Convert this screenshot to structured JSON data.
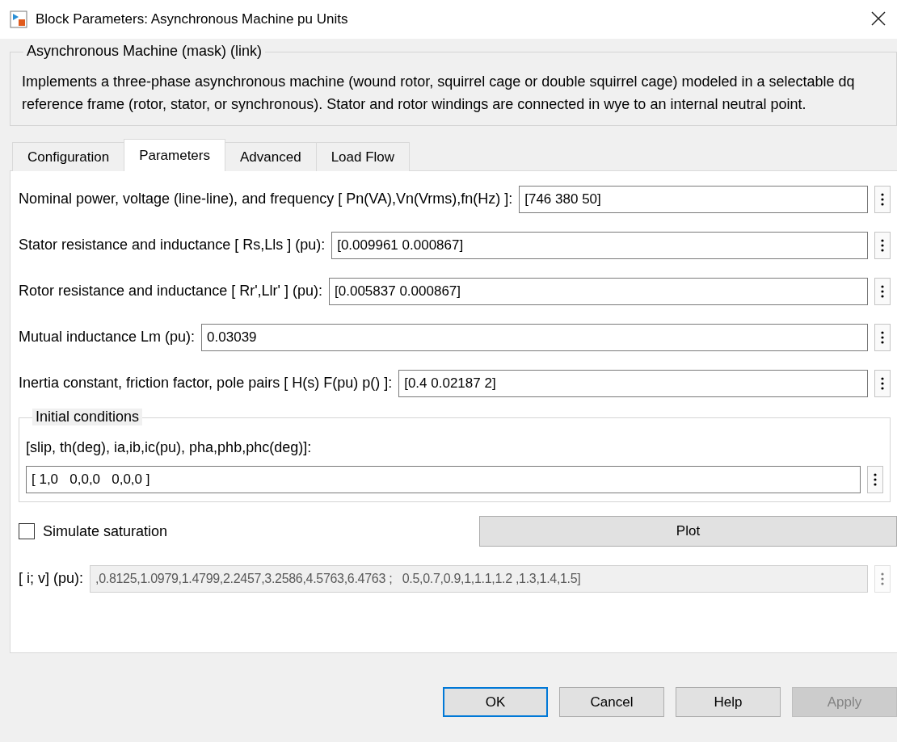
{
  "window": {
    "title": "Block Parameters: Asynchronous Machine pu Units"
  },
  "description": {
    "title": "Asynchronous Machine (mask) (link)",
    "text": "Implements a three-phase asynchronous machine (wound rotor, squirrel cage or double squirrel cage) modeled in a selectable dq reference frame (rotor, stator, or synchronous). Stator and rotor windings are connected in wye to an internal neutral point."
  },
  "tabs": [
    {
      "label": "Configuration",
      "selected": false
    },
    {
      "label": "Parameters",
      "selected": true
    },
    {
      "label": "Advanced",
      "selected": false
    },
    {
      "label": "Load Flow",
      "selected": false
    }
  ],
  "parameters": [
    {
      "label": "Nominal power, voltage (line-line), and frequency  [ Pn(VA),Vn(Vrms),fn(Hz) ]:",
      "value": "[746 380 50]"
    },
    {
      "label": "Stator resistance and inductance  [ Rs,Lls ] (pu):",
      "value": "[0.009961 0.000867]"
    },
    {
      "label": "Rotor resistance and inductance  [ Rr',Llr' ] (pu):",
      "value": "[0.005837 0.000867]"
    },
    {
      "label": "Mutual inductance Lm (pu):",
      "value": "0.03039"
    },
    {
      "label": "Inertia constant, friction factor, pole pairs [ H(s) F(pu)  p() ]:",
      "value": "[0.4 0.02187 2]"
    }
  ],
  "initial_conditions": {
    "title": "Initial conditions",
    "label": "[slip, th(deg), ia,ib,ic(pu), pha,phb,phc(deg)]:",
    "value": "[ 1,0   0,0,0   0,0,0 ]"
  },
  "saturation": {
    "label": "Simulate saturation",
    "checked": false
  },
  "plot_button": "Plot",
  "saturation_data": {
    "label": "[ i; v] (pu):",
    "value": ",0.8125,1.0979,1.4799,2.2457,3.2586,4.5763,6.4763 ;   0.5,0.7,0.9,1,1.1,1.2 ,1.3,1.4,1.5]",
    "disabled": true
  },
  "buttons": [
    {
      "label": "OK",
      "kind": "default",
      "disabled": false
    },
    {
      "label": "Cancel",
      "kind": "normal",
      "disabled": false
    },
    {
      "label": "Help",
      "kind": "normal",
      "disabled": false
    },
    {
      "label": "Apply",
      "kind": "normal",
      "disabled": true
    }
  ]
}
